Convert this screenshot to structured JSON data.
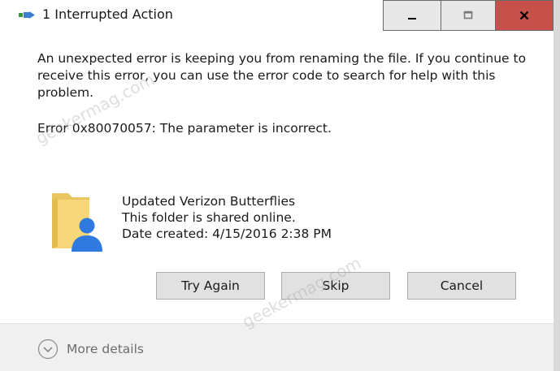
{
  "window": {
    "title": "1 Interrupted Action",
    "controls": {
      "minimize": "minimize-icon",
      "maximize": "maximize-icon",
      "close": "close-icon"
    },
    "colors": {
      "close_button": "#c7504a",
      "title_button": "#e7e7e7"
    }
  },
  "dialog": {
    "message": "An unexpected error is keeping you from renaming the file. If you continue to receive this error, you can use the error code to search for help with this problem.",
    "error": "Error 0x80070057: The parameter is incorrect.",
    "item": {
      "name": "Updated Verizon Butterflies",
      "status": "This folder is shared online.",
      "date_created": "Date created: 4/15/2016 2:38 PM",
      "icon": "shared-folder-icon"
    },
    "buttons": {
      "try_again": "Try Again",
      "skip": "Skip",
      "cancel": "Cancel"
    },
    "footer": {
      "more_details": "More details"
    }
  },
  "watermark": "geekermag.com"
}
